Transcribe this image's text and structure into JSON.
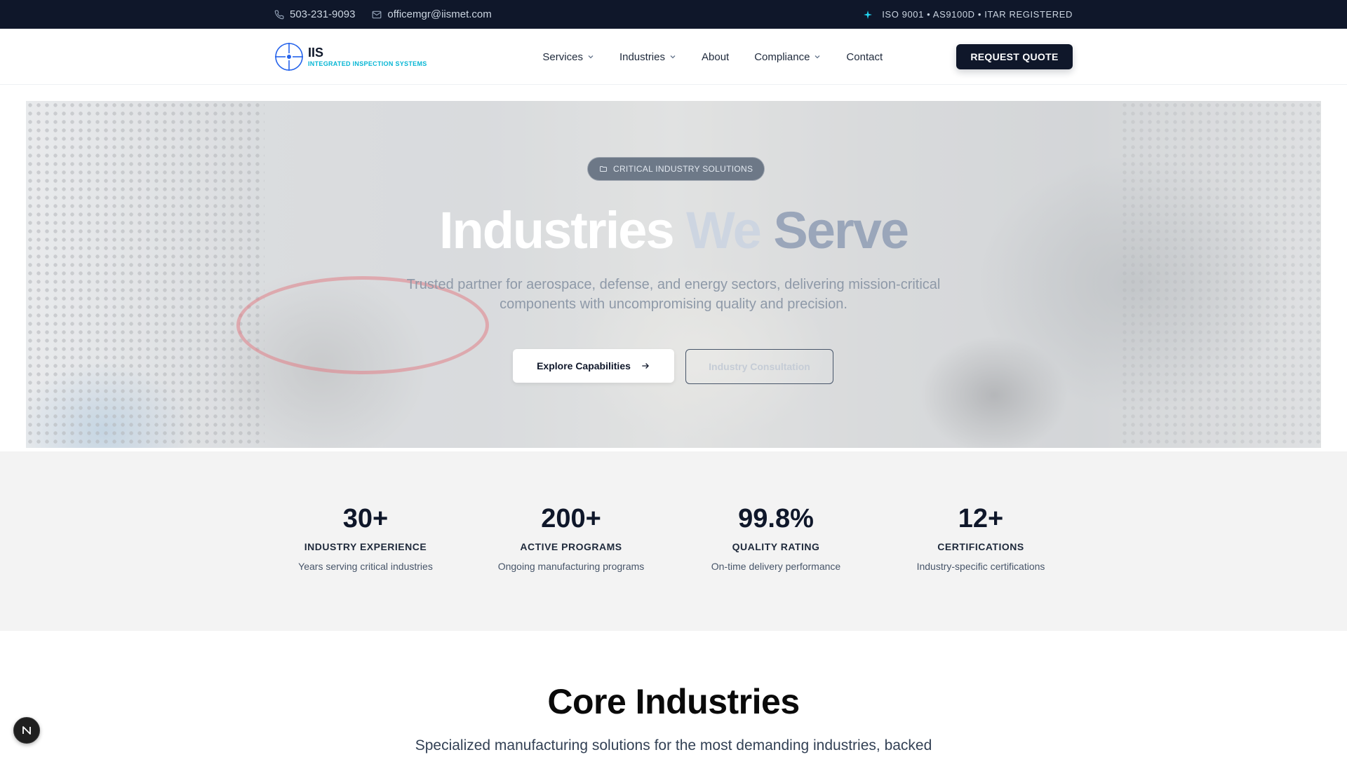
{
  "topbar": {
    "phone": "503-231-9093",
    "email": "officemgr@iismet.com",
    "certs": "ISO 9001 • AS9100D • ITAR REGISTERED"
  },
  "nav": {
    "logo": {
      "brand": "IIS",
      "tagline": "INTEGRATED INSPECTION SYSTEMS"
    },
    "items": [
      {
        "label": "Services",
        "dropdown": true
      },
      {
        "label": "Industries",
        "dropdown": true
      },
      {
        "label": "About",
        "dropdown": false
      },
      {
        "label": "Compliance",
        "dropdown": true
      },
      {
        "label": "Contact",
        "dropdown": false
      }
    ],
    "cta": "REQUEST QUOTE"
  },
  "hero": {
    "badge": "CRITICAL INDUSTRY SOLUTIONS",
    "title_part1": "Industries",
    "title_part2": "We",
    "title_part3": "Serve",
    "subtitle": "Trusted partner for aerospace, defense, and energy sectors, delivering mission-critical components with uncompromising quality and precision.",
    "primary_button": "Explore Capabilities",
    "secondary_button": "Industry Consultation"
  },
  "stats": [
    {
      "value": "30+",
      "label": "INDUSTRY EXPERIENCE",
      "description": "Years serving critical industries"
    },
    {
      "value": "200+",
      "label": "ACTIVE PROGRAMS",
      "description": "Ongoing manufacturing programs"
    },
    {
      "value": "99.8%",
      "label": "QUALITY RATING",
      "description": "On-time delivery performance"
    },
    {
      "value": "12+",
      "label": "CERTIFICATIONS",
      "description": "Industry-specific certifications"
    }
  ],
  "core": {
    "title": "Core Industries",
    "subtitle": "Specialized manufacturing solutions for the most demanding industries, backed"
  },
  "floating_badge": {
    "letter": "N"
  },
  "colors": {
    "navy": "#0f172a",
    "accent_cyan": "#06b6d4",
    "logo_blue": "#2563eb",
    "stats_bg": "#f3f3f3"
  }
}
